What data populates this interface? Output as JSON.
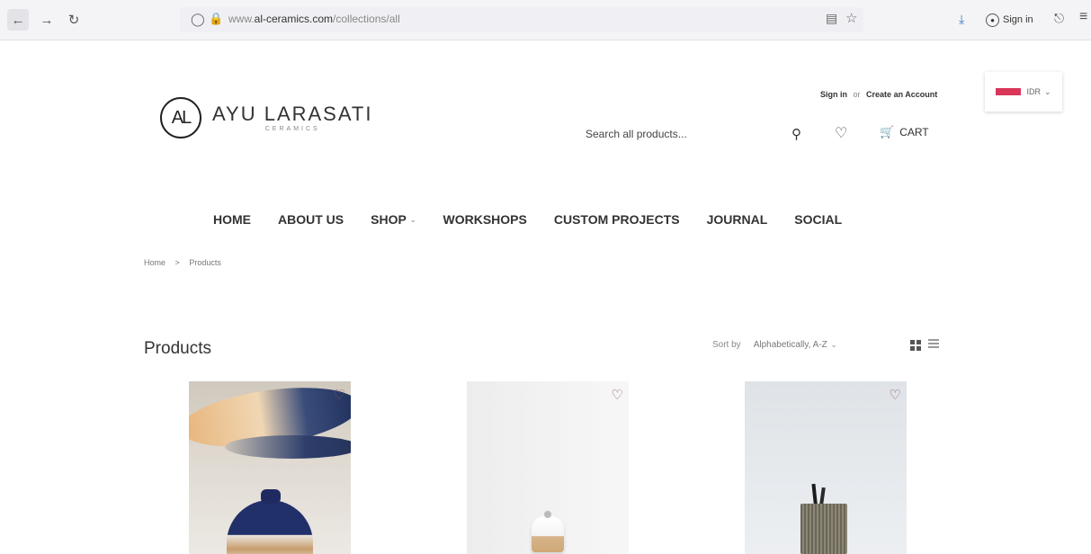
{
  "browser": {
    "url_prefix": "www.",
    "url_domain": "al-ceramics.com",
    "url_path": "/collections/all",
    "signin_label": "Sign in"
  },
  "header": {
    "logo_mark": "AL",
    "brand_name": "AYU LARASATI",
    "brand_sub": "CERAMICS",
    "signin_link": "Sign in",
    "or_text": "or",
    "create_account_link": "Create an Account",
    "currency": "IDR",
    "search_placeholder": "Search all products...",
    "cart_label": "CART"
  },
  "nav": {
    "items": [
      {
        "label": "HOME"
      },
      {
        "label": "ABOUT US"
      },
      {
        "label": "SHOP"
      },
      {
        "label": "WORKSHOPS"
      },
      {
        "label": "CUSTOM PROJECTS"
      },
      {
        "label": "JOURNAL"
      },
      {
        "label": "SOCIAL"
      }
    ]
  },
  "breadcrumb": {
    "home": "Home",
    "separator": ">",
    "current": "Products"
  },
  "collection": {
    "title": "Products",
    "sort_label": "Sort by",
    "sort_value": "Alphabetically, A-Z"
  },
  "colors": {
    "flag": "#d9365a",
    "wishlist_heart": "#8a5a5a",
    "text": "#333333"
  }
}
